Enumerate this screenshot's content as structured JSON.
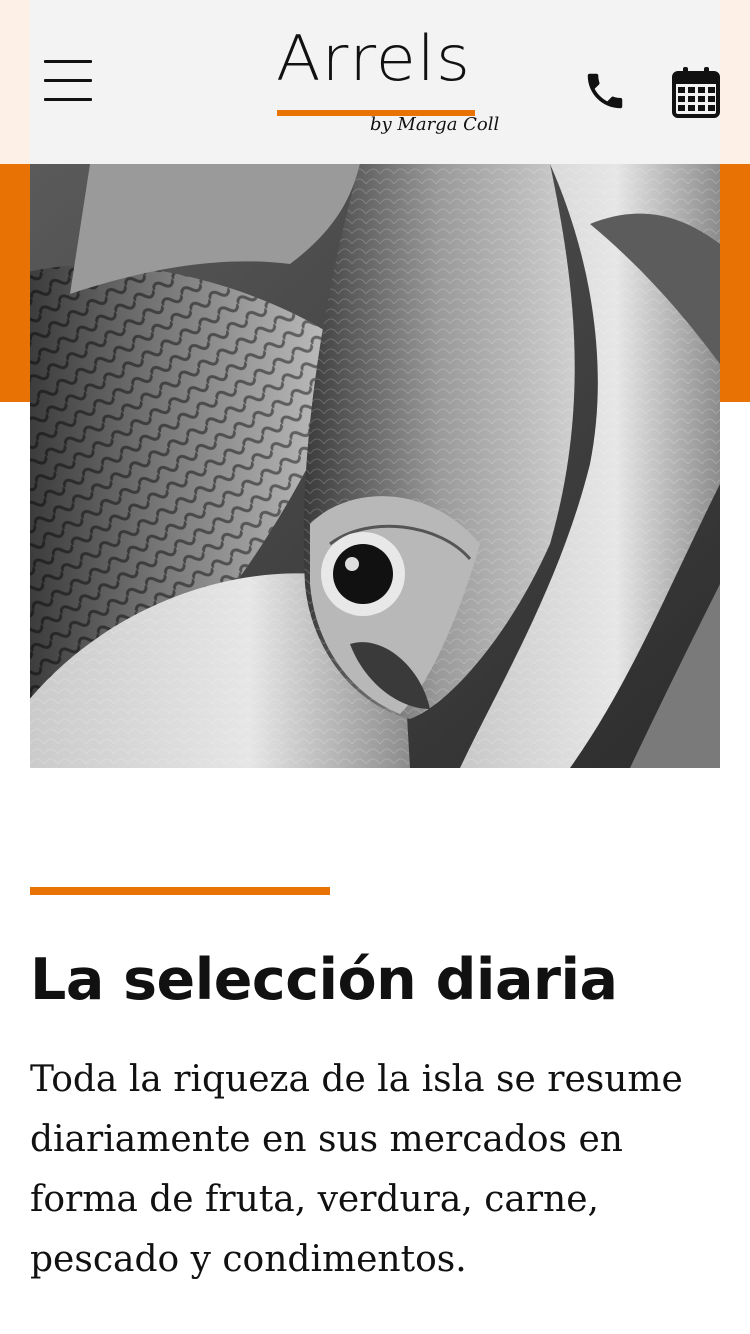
{
  "header": {
    "logo": {
      "wordmark": "Arrels",
      "tagline": "by Marga Coll"
    },
    "icons": {
      "menu": "hamburger-menu-icon",
      "phone": "phone-icon",
      "calendar": "calendar-icon"
    }
  },
  "hero": {
    "image": "black-and-white photo of fresh fish"
  },
  "section": {
    "title": "La selección diaria",
    "description": "Toda la riqueza de la isla se resume diariamente en sus mercados en forma de fruta, verdura, carne, pescado y condimentos."
  },
  "colors": {
    "accent": "#e87203",
    "cream": "#fdf1e7",
    "text": "#111111"
  }
}
